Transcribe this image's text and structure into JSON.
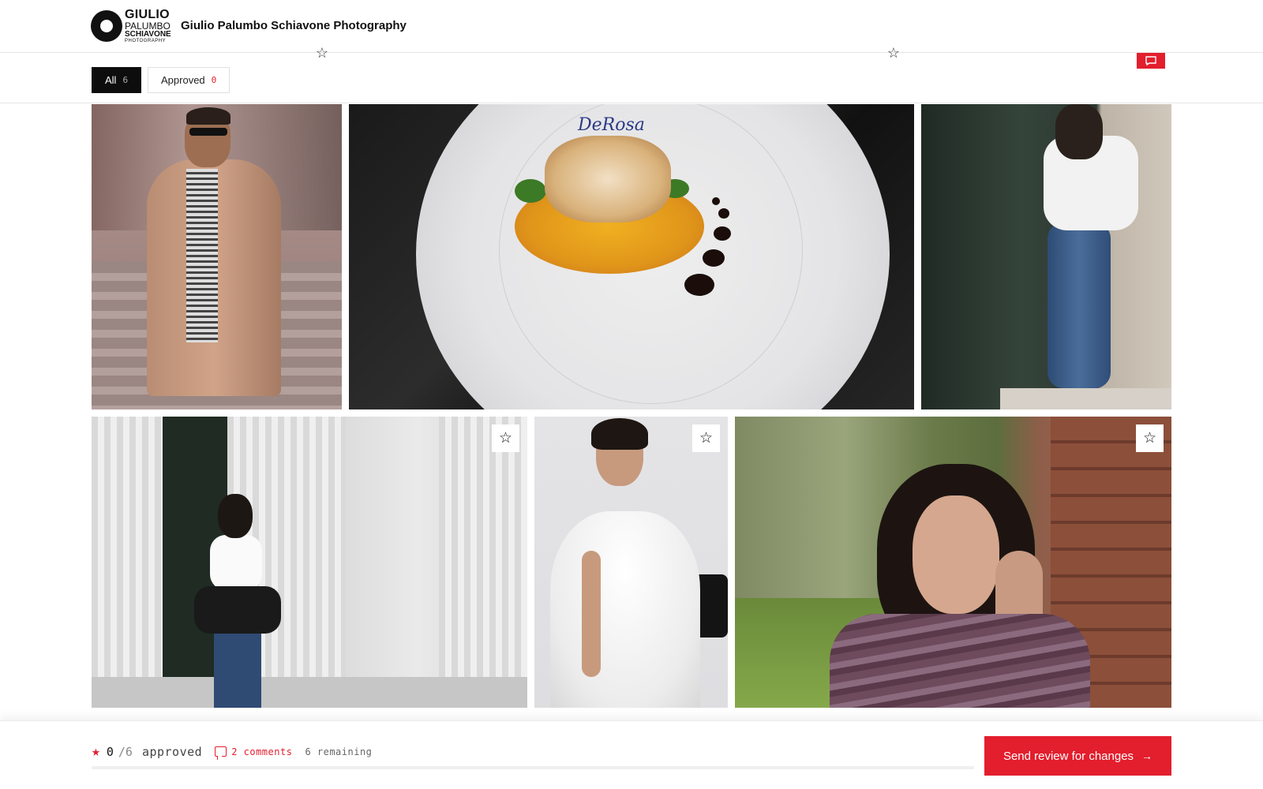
{
  "header": {
    "logo": {
      "line1": "GIULIO",
      "line2": "PALUMBO",
      "line3": "SCHIAVONE",
      "line4": "PHOTOGRAPHY"
    },
    "site_title": "Giulio Palumbo Schiavone Photography"
  },
  "filters": {
    "tabs": [
      {
        "label": "All",
        "count": "6",
        "active": true
      },
      {
        "label": "Approved",
        "count": "0",
        "active": false
      }
    ]
  },
  "photos": [
    {
      "name": "man-camel-coat",
      "favorited": false
    },
    {
      "name": "plated-dish",
      "favorited": false
    },
    {
      "name": "woman-white-shirt",
      "favorited": false
    },
    {
      "name": "woman-columns",
      "favorited": false,
      "star_icon": "star-outline-icon"
    },
    {
      "name": "bride",
      "favorited": false,
      "star_icon": "star-outline-icon"
    },
    {
      "name": "woman-brick-wall",
      "favorited": false,
      "star_icon": "star-outline-icon"
    }
  ],
  "photo2_brand_text": "DeRosa",
  "icons": {
    "star_outline": "☆",
    "star_filled": "★",
    "arrow_right": "→"
  },
  "footer": {
    "approved_count": "0",
    "total": "/6",
    "approved_label": "approved",
    "comments_label": "2 comments",
    "remaining_label": "6 remaining",
    "progress_fraction": 0,
    "send_button_label": "Send review for changes"
  },
  "colors": {
    "accent": "#e31e2d",
    "active_tab_bg": "#0d0d0d",
    "text": "#111111"
  }
}
